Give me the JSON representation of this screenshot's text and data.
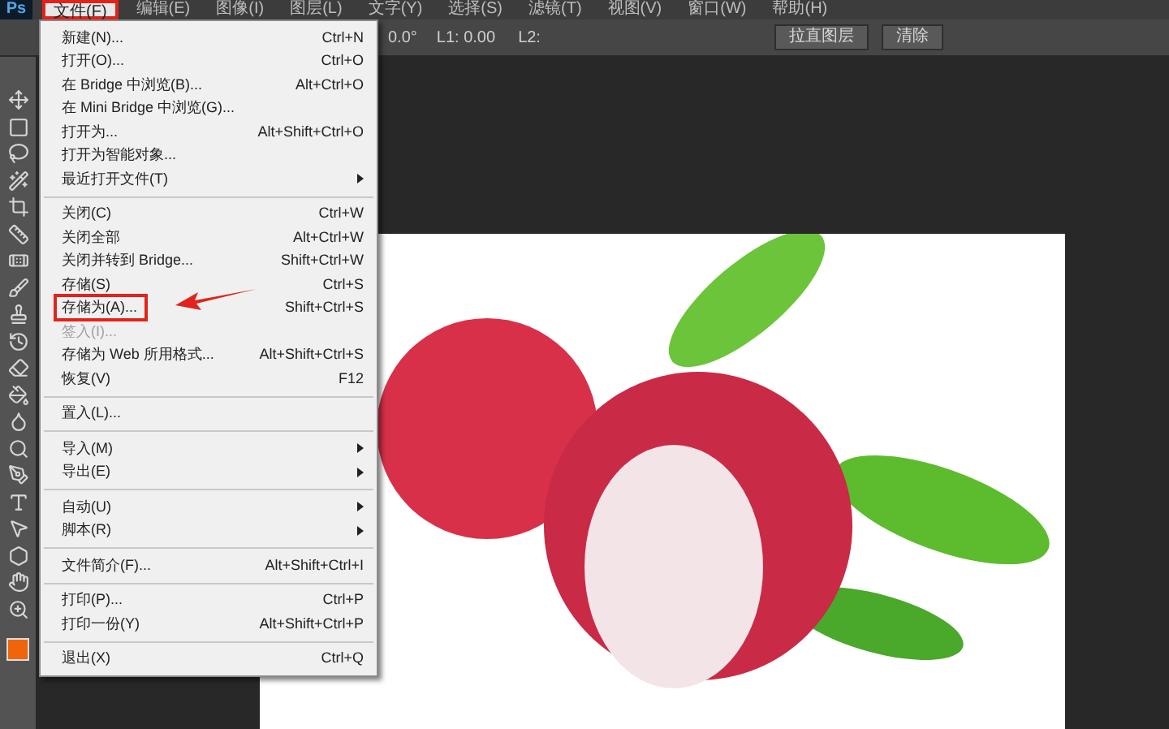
{
  "app": {
    "logo": "Ps"
  },
  "menu_bar": [
    {
      "label": "文件(F)",
      "selected": true,
      "annotated": true
    },
    {
      "label": "编辑(E)",
      "selected": false,
      "annotated": false
    },
    {
      "label": "图像(I)",
      "selected": false,
      "annotated": false
    },
    {
      "label": "图层(L)",
      "selected": false,
      "annotated": false
    },
    {
      "label": "文字(Y)",
      "selected": false,
      "annotated": false
    },
    {
      "label": "选择(S)",
      "selected": false,
      "annotated": false
    },
    {
      "label": "滤镜(T)",
      "selected": false,
      "annotated": false
    },
    {
      "label": "视图(V)",
      "selected": false,
      "annotated": false
    },
    {
      "label": "窗口(W)",
      "selected": false,
      "annotated": false
    },
    {
      "label": "帮助(H)",
      "selected": false,
      "annotated": false
    }
  ],
  "options_bar": {
    "angle": "0.0°",
    "l1": "L1: 0.00",
    "l2": "L2:",
    "buttons": [
      "拉直图层",
      "清除"
    ]
  },
  "file_menu": [
    {
      "kind": "item",
      "label": "新建(N)...",
      "shortcut": "Ctrl+N",
      "disabled": false,
      "annotated": false
    },
    {
      "kind": "item",
      "label": "打开(O)...",
      "shortcut": "Ctrl+O",
      "disabled": false,
      "annotated": false
    },
    {
      "kind": "item",
      "label": "在 Bridge 中浏览(B)...",
      "shortcut": "Alt+Ctrl+O",
      "disabled": false,
      "annotated": false
    },
    {
      "kind": "item",
      "label": "在 Mini Bridge 中浏览(G)...",
      "disabled": false,
      "annotated": false
    },
    {
      "kind": "item",
      "label": "打开为...",
      "shortcut": "Alt+Shift+Ctrl+O",
      "disabled": false,
      "annotated": false
    },
    {
      "kind": "item",
      "label": "打开为智能对象...",
      "disabled": false,
      "annotated": false
    },
    {
      "kind": "submenu",
      "label": "最近打开文件(T)",
      "disabled": false,
      "annotated": false
    },
    {
      "kind": "separator"
    },
    {
      "kind": "item",
      "label": "关闭(C)",
      "shortcut": "Ctrl+W",
      "disabled": false,
      "annotated": false
    },
    {
      "kind": "item",
      "label": "关闭全部",
      "shortcut": "Alt+Ctrl+W",
      "disabled": false,
      "annotated": false
    },
    {
      "kind": "item",
      "label": "关闭并转到 Bridge...",
      "shortcut": "Shift+Ctrl+W",
      "disabled": false,
      "annotated": false
    },
    {
      "kind": "item",
      "label": "存储(S)",
      "shortcut": "Ctrl+S",
      "disabled": false,
      "annotated": false
    },
    {
      "kind": "item",
      "label": "存储为(A)...",
      "shortcut": "Shift+Ctrl+S",
      "disabled": false,
      "annotated": true
    },
    {
      "kind": "item",
      "label": "签入(I)...",
      "disabled": true,
      "annotated": false
    },
    {
      "kind": "item",
      "label": "存储为 Web 所用格式...",
      "shortcut": "Alt+Shift+Ctrl+S",
      "disabled": false,
      "annotated": false
    },
    {
      "kind": "item",
      "label": "恢复(V)",
      "shortcut": "F12",
      "disabled": false,
      "annotated": false
    },
    {
      "kind": "separator"
    },
    {
      "kind": "item",
      "label": "置入(L)...",
      "disabled": false,
      "annotated": false
    },
    {
      "kind": "separator"
    },
    {
      "kind": "submenu",
      "label": "导入(M)",
      "disabled": false,
      "annotated": false
    },
    {
      "kind": "submenu",
      "label": "导出(E)",
      "disabled": false,
      "annotated": false
    },
    {
      "kind": "separator"
    },
    {
      "kind": "submenu",
      "label": "自动(U)",
      "disabled": false,
      "annotated": false
    },
    {
      "kind": "submenu",
      "label": "脚本(R)",
      "disabled": false,
      "annotated": false
    },
    {
      "kind": "separator"
    },
    {
      "kind": "item",
      "label": "文件简介(F)...",
      "shortcut": "Alt+Shift+Ctrl+I",
      "disabled": false,
      "annotated": false
    },
    {
      "kind": "separator"
    },
    {
      "kind": "item",
      "label": "打印(P)...",
      "shortcut": "Ctrl+P",
      "disabled": false,
      "annotated": false
    },
    {
      "kind": "item",
      "label": "打印一份(Y)",
      "shortcut": "Alt+Shift+Ctrl+P",
      "disabled": false,
      "annotated": false
    },
    {
      "kind": "separator"
    },
    {
      "kind": "item",
      "label": "退出(X)",
      "shortcut": "Ctrl+Q",
      "disabled": false,
      "annotated": false
    }
  ]
}
